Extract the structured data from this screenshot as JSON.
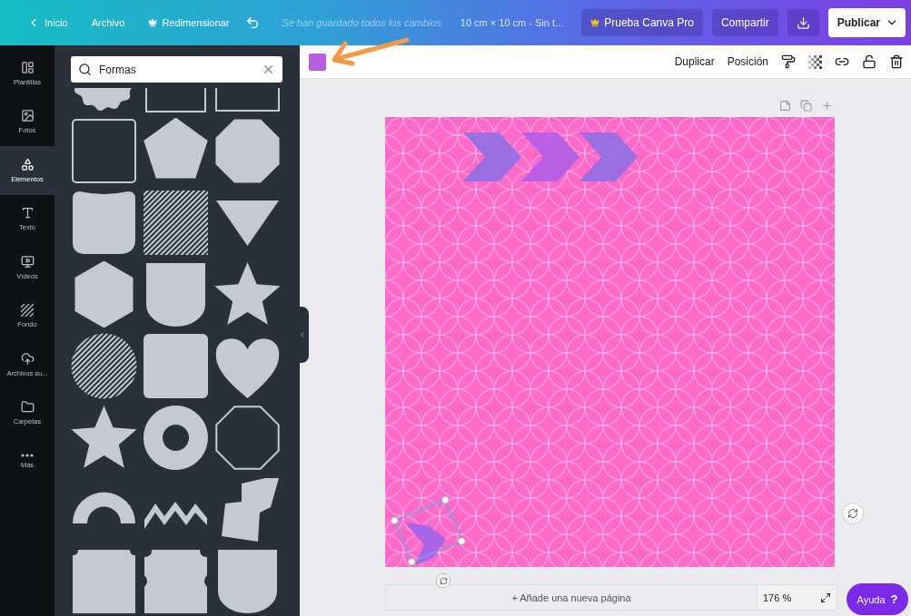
{
  "topbar": {
    "home": "Inicio",
    "menu": [
      {
        "label": "Archivo",
        "kind": "plain"
      },
      {
        "label": "Redimensionar",
        "kind": "pro"
      }
    ],
    "status": "Se han guardado todos los cambios",
    "doc_title": "10 cm × 10 cm - Sin t...",
    "pro": "Prueba Canva Pro",
    "share": "Compartir",
    "publish": "Publicar"
  },
  "rail": [
    {
      "label": "Plantillas",
      "selected": false
    },
    {
      "label": "Fotos",
      "selected": false
    },
    {
      "label": "Elementos",
      "selected": true
    },
    {
      "label": "Texto",
      "selected": false
    },
    {
      "label": "Vídeos",
      "selected": false
    },
    {
      "label": "Fondo",
      "selected": false
    },
    {
      "label": "Archivos su...",
      "selected": false
    },
    {
      "label": "Carpetas",
      "selected": false
    },
    {
      "label": "Más",
      "selected": false
    }
  ],
  "search": {
    "value": "Formas"
  },
  "shapes": [
    {
      "kind": "scallop"
    },
    {
      "kind": "arch"
    },
    {
      "kind": "frame"
    },
    {
      "kind": "rounded-frame"
    },
    {
      "kind": "pentagon"
    },
    {
      "kind": "octagon"
    },
    {
      "kind": "tag"
    },
    {
      "kind": "hatched-square"
    },
    {
      "kind": "triangle"
    },
    {
      "kind": "hexagon"
    },
    {
      "kind": "shield"
    },
    {
      "kind": "star"
    },
    {
      "kind": "hatched-circle"
    },
    {
      "kind": "rounded-square"
    },
    {
      "kind": "heart"
    },
    {
      "kind": "star"
    },
    {
      "kind": "ring"
    },
    {
      "kind": "octagon-frame"
    },
    {
      "kind": "arc"
    },
    {
      "kind": "zigzag"
    },
    {
      "kind": "lightning"
    },
    {
      "kind": "ticket"
    },
    {
      "kind": "badge"
    },
    {
      "kind": "shield"
    }
  ],
  "toolbar": {
    "color": "#b65ee0",
    "buttons": [
      "Duplicar",
      "Posición"
    ]
  },
  "footer": {
    "add_page": "+ Añade una nueva página",
    "zoom": "176 %",
    "help": "Ayuda",
    "help_mark": "?"
  }
}
